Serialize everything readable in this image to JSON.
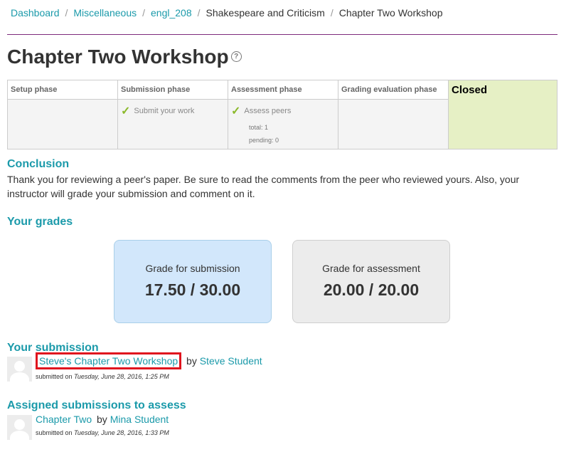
{
  "breadcrumb": [
    {
      "label": "Dashboard",
      "link": true
    },
    {
      "label": "Miscellaneous",
      "link": true
    },
    {
      "label": "engl_208",
      "link": true
    },
    {
      "label": "Shakespeare and Criticism",
      "link": false
    },
    {
      "label": "Chapter Two Workshop",
      "link": false
    }
  ],
  "page": {
    "title": "Chapter Two Workshop",
    "help_icon": "?"
  },
  "phases": {
    "setup": {
      "label": "Setup phase"
    },
    "submission": {
      "label": "Submission phase",
      "task": "Submit your work"
    },
    "assessment": {
      "label": "Assessment phase",
      "task": "Assess peers",
      "total": "total: 1",
      "pending": "pending: 0"
    },
    "grading": {
      "label": "Grading evaluation phase"
    },
    "closed": {
      "label": "Closed"
    }
  },
  "conclusion": {
    "heading": "Conclusion",
    "text": "Thank you for reviewing a peer's paper. Be sure to read the comments from the peer who reviewed yours. Also, your instructor will grade your submission and comment on it."
  },
  "grades": {
    "heading": "Your grades",
    "submission": {
      "label": "Grade for submission",
      "value": "17.50 / 30.00"
    },
    "assessment": {
      "label": "Grade for assessment",
      "value": "20.00 / 20.00"
    }
  },
  "your_submission": {
    "heading": "Your submission",
    "title": "Steve's Chapter Two Workshop",
    "by": "by",
    "author": "Steve Student",
    "submitted_label": "submitted on",
    "submitted_date": "Tuesday, June 28, 2016, 1:25 PM"
  },
  "assigned": {
    "heading": "Assigned submissions to assess",
    "title": "Chapter Two",
    "by": "by",
    "author": "Mina Student",
    "submitted_label": "submitted on",
    "submitted_date": "Tuesday, June 28, 2016, 1:33 PM"
  },
  "colors": {
    "accent": "#1b9aaa",
    "closed_bg": "#e6f0c5",
    "highlight": "#e0141e"
  }
}
